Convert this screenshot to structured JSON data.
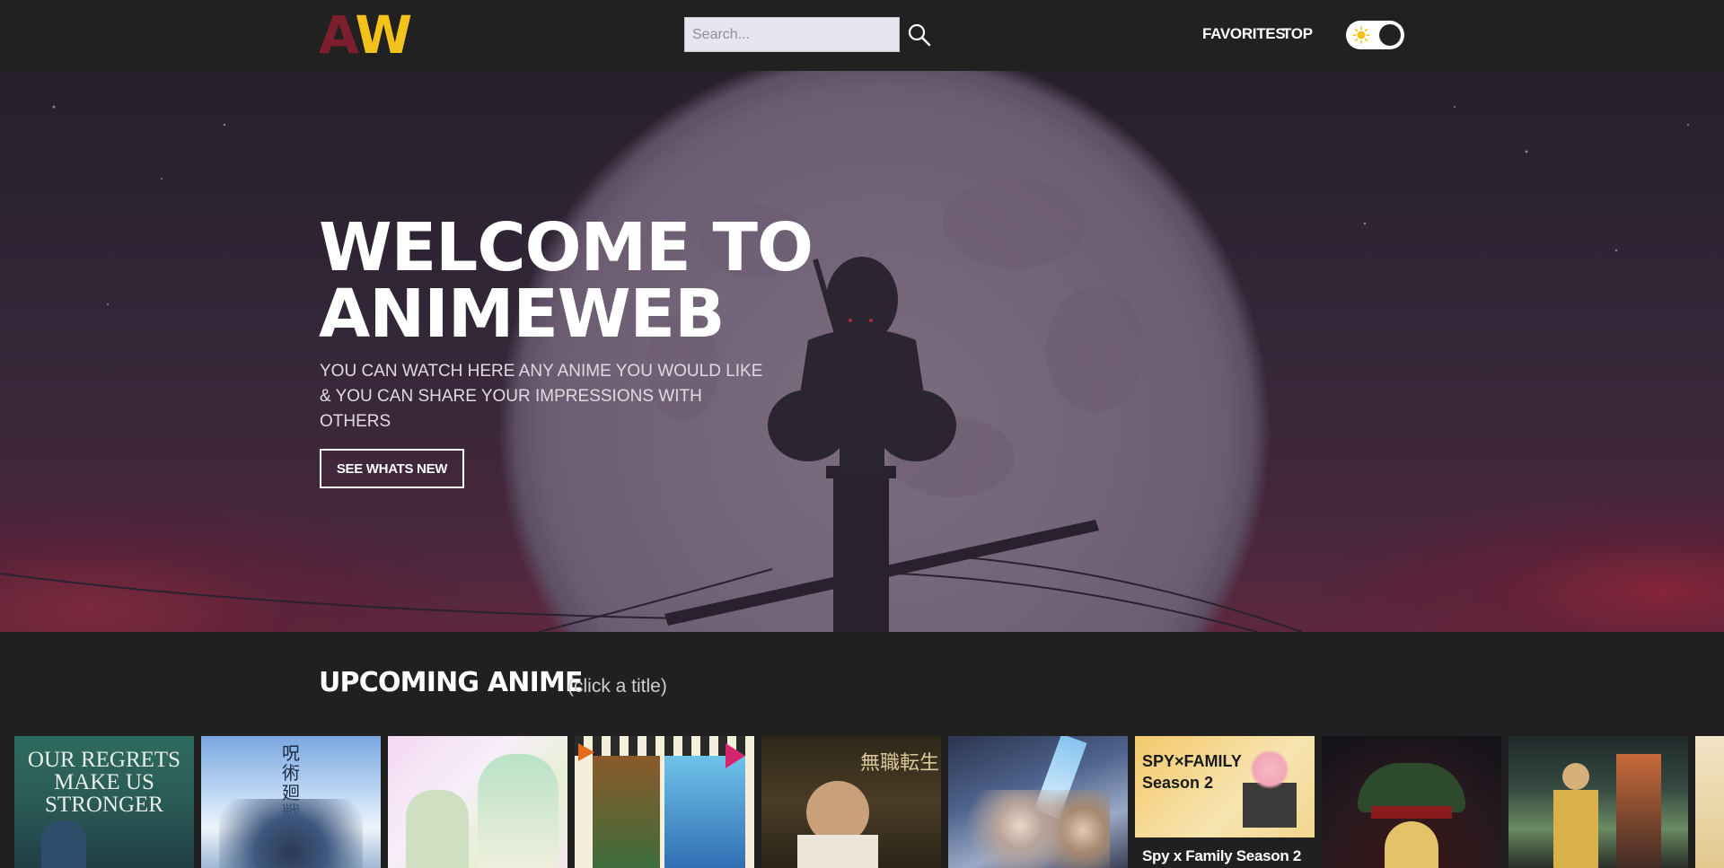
{
  "header": {
    "logo_left": "A",
    "logo_right": "W",
    "search_placeholder": "Search...",
    "nav": {
      "favorites": "FAVORITES",
      "top": "TOP"
    },
    "theme_toggle": "dark"
  },
  "hero": {
    "title": "WELCOME TO ANIMEWEB",
    "subtitle": "YOU CAN WATCH HERE ANY ANIME YOU WOULD LIKE & YOU CAN SHARE YOUR IMPRESSIONS WITH OTHERS",
    "button_label": "SEE WHATS NEW"
  },
  "upcoming": {
    "title": "UPCOMING ANIME",
    "hint": "(click a title)",
    "cards": [
      {
        "poster_text": "OUR REGRETS MAKE US STRONGER",
        "caption": ""
      },
      {
        "poster_text": "呪術廻戦",
        "caption": ""
      },
      {
        "poster_text": "",
        "caption": ""
      },
      {
        "poster_text": "",
        "caption": ""
      },
      {
        "poster_text": "無職転生",
        "caption": ""
      },
      {
        "poster_text": "",
        "caption": ""
      },
      {
        "poster_text": "SPY×FAMILY Season 2",
        "caption": "Spy x Family Season 2"
      },
      {
        "poster_text": "",
        "caption": ""
      },
      {
        "poster_text": "",
        "caption": ""
      },
      {
        "poster_text": "",
        "caption": ""
      }
    ]
  },
  "colors": {
    "logo_a": "#7a1f2b",
    "logo_w": "#f2c21b",
    "header_bg": "#212121",
    "page_bg": "#202020"
  }
}
